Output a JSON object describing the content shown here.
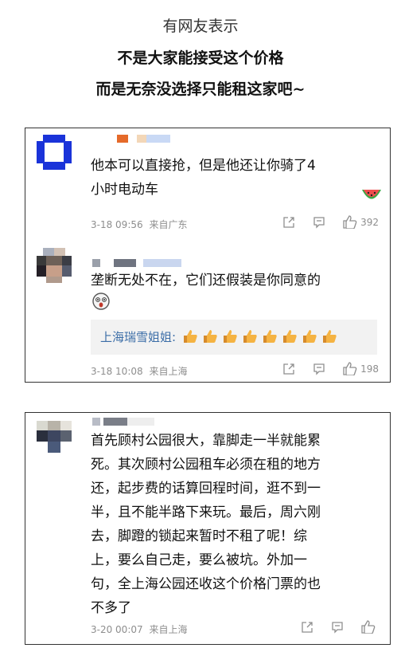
{
  "header": {
    "line1": "有网友表示",
    "line2": "不是大家能接受这个价格",
    "line3": "而是无奈没选择只能租这家吧~"
  },
  "comments": [
    {
      "text_lines": [
        "他本可以直接抢，但是他还让你骑了4",
        "小时电动车"
      ],
      "date": "3-18 09:56",
      "location": "来自广东",
      "likes": "392",
      "sticker": "watermelon-emoji"
    },
    {
      "text_lines": [
        "垄断无处不在，它们还假装是你同意的"
      ],
      "sticker": "surprised-face-emoji",
      "reply": {
        "author": "上海瑞雪姐姐:",
        "thumbs_count": 8
      },
      "date": "3-18 10:08",
      "location": "来自上海",
      "likes": "198"
    },
    {
      "text_lines": [
        "首先顾村公园很大，靠脚走一半就能累",
        "死。其次顾村公园租车必须在租的地方",
        "还，起步费的话算回程时间，逛不到一",
        "半，且不能半路下来玩。最后，周六刚",
        "去，脚蹬的锁起来暂时不租了呢！综",
        "上，要么自己走，要么被坑。外加一",
        "句，全上海公园还收这个价格门票的也",
        "不多了"
      ],
      "date": "3-20 00:07",
      "location": "来自上海",
      "likes": ""
    }
  ],
  "icons": {
    "share": "share-icon",
    "comment": "comment-icon",
    "like": "thumbs-up-icon"
  },
  "colors": {
    "reply_author": "#3b6da7",
    "meta": "#8e8e8e"
  }
}
